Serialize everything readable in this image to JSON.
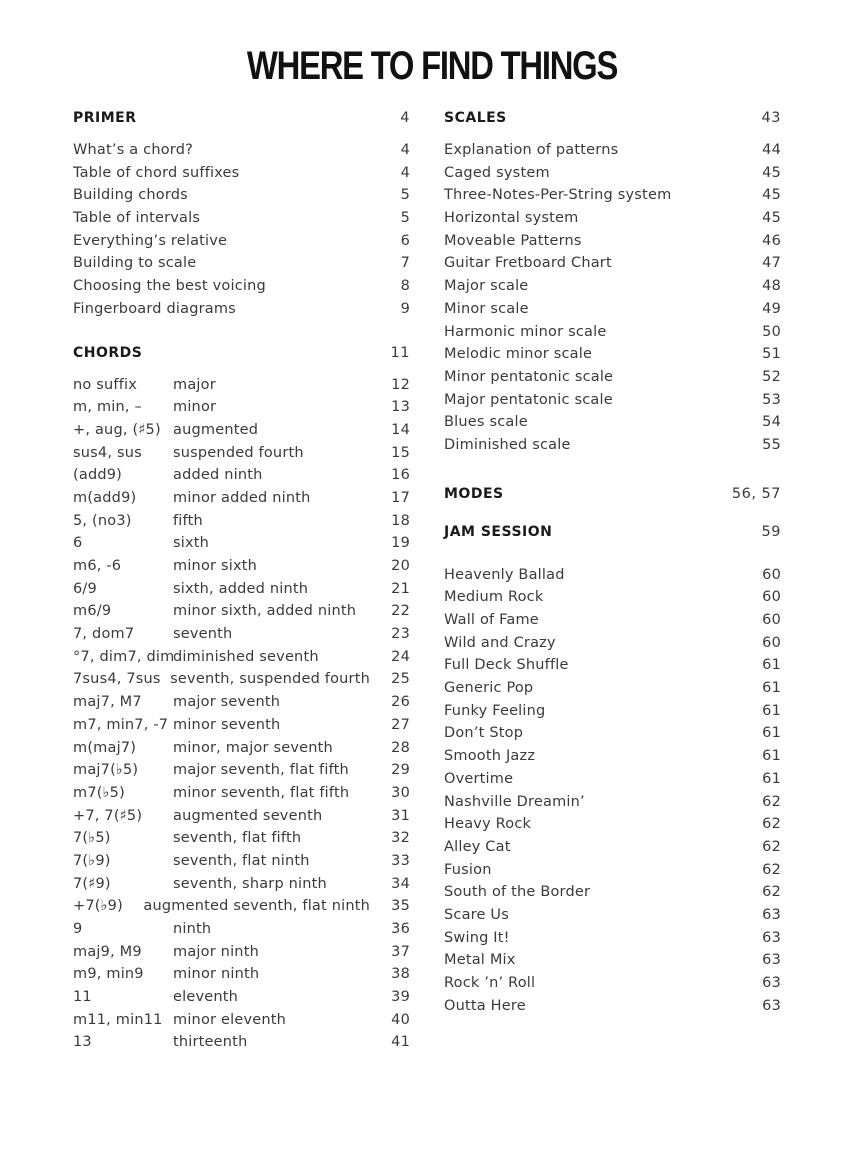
{
  "title": "WHERE TO FIND THINGS",
  "left_column": {
    "primer": {
      "heading": "PRIMER",
      "page": "4",
      "items": [
        {
          "label": "What’s a chord?",
          "page": "4"
        },
        {
          "label": "Table of chord suffixes",
          "page": "4"
        },
        {
          "label": "Building chords",
          "page": "5"
        },
        {
          "label": "Table of intervals",
          "page": "5"
        },
        {
          "label": "Everything’s relative",
          "page": "6"
        },
        {
          "label": "Building to scale",
          "page": "7"
        },
        {
          "label": "Choosing the best voicing",
          "page": "8"
        },
        {
          "label": "Fingerboard diagrams",
          "page": "9"
        }
      ]
    },
    "chords": {
      "heading": "CHORDS",
      "page": "11",
      "items": [
        {
          "suffix": "no suffix",
          "name": "major",
          "page": "12"
        },
        {
          "suffix": "m, min, –",
          "name": "minor",
          "page": "13"
        },
        {
          "suffix": "+, aug, (♯5)",
          "name": "augmented",
          "page": "14"
        },
        {
          "suffix": "sus4, sus",
          "name": "suspended fourth",
          "page": "15"
        },
        {
          "suffix": "(add9)",
          "name": "added ninth",
          "page": "16"
        },
        {
          "suffix": "m(add9)",
          "name": "minor added ninth",
          "page": "17"
        },
        {
          "suffix": "5, (no3)",
          "name": "fifth",
          "page": "18"
        },
        {
          "suffix": "6",
          "name": "sixth",
          "page": "19"
        },
        {
          "suffix": "m6, -6",
          "name": "minor sixth",
          "page": "20"
        },
        {
          "suffix": "6/9",
          "name": "sixth, added ninth",
          "page": "21"
        },
        {
          "suffix": "m6/9",
          "name": "minor sixth, added ninth",
          "page": "22"
        },
        {
          "suffix": "7, dom7",
          "name": "seventh",
          "page": "23"
        },
        {
          "suffix": "°7, dim7, dim",
          "name": "diminished seventh",
          "page": "24"
        },
        {
          "suffix": "7sus4, 7sus",
          "name": "seventh, suspended fourth",
          "page": "25"
        },
        {
          "suffix": "maj7, M7",
          "name": "major seventh",
          "page": "26"
        },
        {
          "suffix": "m7, min7, -7",
          "name": "minor seventh",
          "page": "27"
        },
        {
          "suffix": "m(maj7)",
          "name": "minor, major seventh",
          "page": "28"
        },
        {
          "suffix": "maj7(♭5)",
          "name": "major seventh, flat fifth",
          "page": "29"
        },
        {
          "suffix": "m7(♭5)",
          "name": "minor seventh, flat fifth",
          "page": "30"
        },
        {
          "suffix": "+7, 7(♯5)",
          "name": "augmented seventh",
          "page": "31"
        },
        {
          "suffix": "7(♭5)",
          "name": "seventh, flat fifth",
          "page": "32"
        },
        {
          "suffix": "7(♭9)",
          "name": "seventh, flat ninth",
          "page": "33"
        },
        {
          "suffix": "7(♯9)",
          "name": "seventh, sharp ninth",
          "page": "34"
        },
        {
          "suffix": "+7(♭9)",
          "name": "augmented seventh, flat ninth",
          "page": "35"
        },
        {
          "suffix": "9",
          "name": "ninth",
          "page": "36"
        },
        {
          "suffix": "maj9, M9",
          "name": "major ninth",
          "page": "37"
        },
        {
          "suffix": "m9, min9",
          "name": "minor ninth",
          "page": "38"
        },
        {
          "suffix": "11",
          "name": "eleventh",
          "page": "39"
        },
        {
          "suffix": "m11, min11",
          "name": "minor eleventh",
          "page": "40"
        },
        {
          "suffix": "13",
          "name": "thirteenth",
          "page": "41"
        }
      ]
    }
  },
  "right_column": {
    "scales": {
      "heading": "SCALES",
      "page": "43",
      "items": [
        {
          "label": "Explanation of patterns",
          "page": "44"
        },
        {
          "label": "Caged system",
          "page": "45"
        },
        {
          "label": "Three-Notes-Per-String system",
          "page": "45"
        },
        {
          "label": "Horizontal system",
          "page": "45"
        },
        {
          "label": "Moveable Patterns",
          "page": "46"
        },
        {
          "label": "Guitar Fretboard Chart",
          "page": "47"
        },
        {
          "label": "Major scale",
          "page": "48"
        },
        {
          "label": "Minor scale",
          "page": "49"
        },
        {
          "label": "Harmonic minor scale",
          "page": "50"
        },
        {
          "label": "Melodic minor scale",
          "page": "51"
        },
        {
          "label": "Minor pentatonic scale",
          "page": "52"
        },
        {
          "label": "Major pentatonic scale",
          "page": "53"
        },
        {
          "label": "Blues scale",
          "page": "54"
        },
        {
          "label": "Diminished scale",
          "page": "55"
        }
      ]
    },
    "modes": {
      "heading": "MODES",
      "page": "56, 57"
    },
    "jam_session": {
      "heading": "JAM SESSION",
      "page": "59",
      "items": [
        {
          "label": "Heavenly Ballad",
          "page": "60"
        },
        {
          "label": "Medium Rock",
          "page": "60"
        },
        {
          "label": "Wall of Fame",
          "page": "60"
        },
        {
          "label": "Wild and Crazy",
          "page": "60"
        },
        {
          "label": "Full Deck Shuffle",
          "page": "61"
        },
        {
          "label": "Generic Pop",
          "page": "61"
        },
        {
          "label": "Funky Feeling",
          "page": "61"
        },
        {
          "label": "Don’t Stop",
          "page": "61"
        },
        {
          "label": "Smooth Jazz",
          "page": "61"
        },
        {
          "label": "Overtime",
          "page": "61"
        },
        {
          "label": "Nashville Dreamin’",
          "page": "62"
        },
        {
          "label": "Heavy Rock",
          "page": "62"
        },
        {
          "label": "Alley Cat",
          "page": "62"
        },
        {
          "label": "Fusion",
          "page": "62"
        },
        {
          "label": "South of the Border",
          "page": "62"
        },
        {
          "label": "Scare Us",
          "page": "63"
        },
        {
          "label": "Swing It!",
          "page": "63"
        },
        {
          "label": "Metal Mix",
          "page": "63"
        },
        {
          "label": "Rock ’n’ Roll",
          "page": "63"
        },
        {
          "label": "Outta Here",
          "page": "63"
        }
      ]
    }
  }
}
